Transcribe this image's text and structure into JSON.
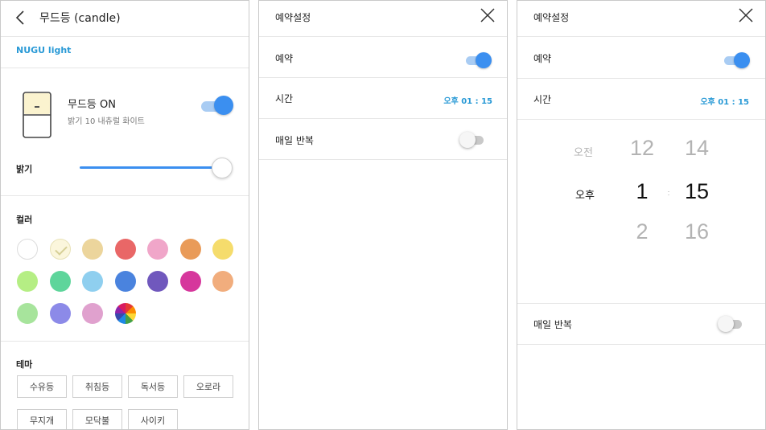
{
  "colors": {
    "accent": "#3b8ff0",
    "link": "#2a9ad6",
    "toggle_track_on": "#a9ccf3",
    "toggle_track_off": "#c9c9c9"
  },
  "device_screen": {
    "title": "무드등 (candle)",
    "back_icon": "chevron-left-icon",
    "tab": "NUGU light",
    "device": {
      "icon": "mood-lamp-icon",
      "name": "무드등 ON",
      "status": "밝기 10 내츄럴 화이트",
      "power_on": true
    },
    "brightness": {
      "label": "밝기",
      "level_fraction": 1.0
    },
    "color_section": {
      "label": "컬러",
      "swatches": [
        {
          "color": "#ffffff",
          "selected": false
        },
        {
          "color": "#fbf6dc",
          "selected": true
        },
        {
          "color": "#ecd59c",
          "selected": false
        },
        {
          "color": "#e96767",
          "selected": false
        },
        {
          "color": "#f0a6c9",
          "selected": false
        },
        {
          "color": "#e99b59",
          "selected": false
        },
        {
          "color": "#f5dc6c",
          "selected": false
        },
        {
          "color": "#b5ee84",
          "selected": false
        },
        {
          "color": "#5ed59b",
          "selected": false
        },
        {
          "color": "#8fcfef",
          "selected": false
        },
        {
          "color": "#4a83de",
          "selected": false
        },
        {
          "color": "#7058bd",
          "selected": false
        },
        {
          "color": "#d6379c",
          "selected": false
        },
        {
          "color": "#f1ad7d",
          "selected": false
        },
        {
          "color": "#a7e49c",
          "selected": false
        },
        {
          "color": "#8c8ae8",
          "selected": false
        },
        {
          "color": "#e0a1ce",
          "selected": false
        },
        {
          "color": "rainbow",
          "selected": false
        }
      ]
    },
    "theme_section": {
      "label": "테마",
      "buttons": [
        "수유등",
        "취침등",
        "독서등",
        "오로라",
        "무지개",
        "모닥불",
        "사이키"
      ]
    }
  },
  "schedule_screen": {
    "title": "예약설정",
    "close_icon": "close-icon",
    "reservation": {
      "label": "예약",
      "enabled": true
    },
    "time": {
      "label": "시간",
      "value": "오후 01 : 15"
    },
    "repeat": {
      "label": "매일 반복",
      "enabled": false
    }
  },
  "schedule_picker_screen": {
    "title": "예약설정",
    "close_icon": "close-icon",
    "reservation": {
      "label": "예약",
      "enabled": true
    },
    "time": {
      "label": "시간",
      "value": "오후 01 : 15"
    },
    "picker": {
      "ampm": {
        "above": "오전",
        "selected": "오후"
      },
      "hours": {
        "above": "12",
        "selected": "1",
        "below": "2"
      },
      "separator": ":",
      "minutes": {
        "above": "14",
        "selected": "15",
        "below": "16"
      }
    },
    "repeat": {
      "label": "매일 반복",
      "enabled": false
    }
  }
}
